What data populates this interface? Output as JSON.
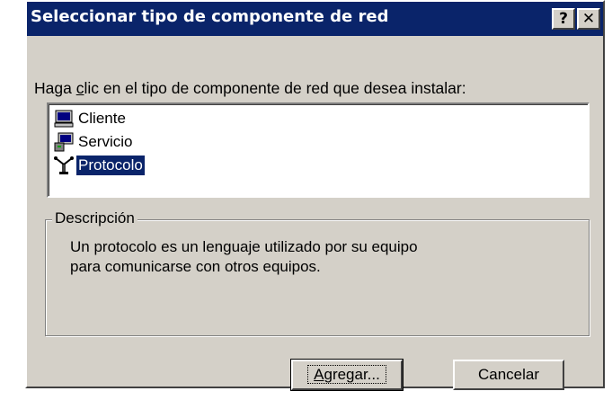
{
  "window": {
    "title": "Seleccionar tipo de componente de red",
    "help_label": "?",
    "close_label": "✕"
  },
  "prompt": {
    "before": "Haga ",
    "underlined": "c",
    "after": "lic en el tipo de componente de red que desea instalar:"
  },
  "list": {
    "items": [
      {
        "label": "Cliente",
        "icon": "computer-icon"
      },
      {
        "label": "Servicio",
        "icon": "server-icon"
      },
      {
        "label": "Protocolo",
        "icon": "network-protocol-icon"
      }
    ],
    "selected": "Protocolo"
  },
  "description": {
    "group_title": "Descripción",
    "line1": "Un protocolo es un lenguaje utilizado por su equipo",
    "line2": "para comunicarse con otros equipos."
  },
  "buttons": {
    "add_underlined": "A",
    "add_rest": "gregar...",
    "cancel": "Cancelar"
  },
  "colors": {
    "titlebar": "#0a246a",
    "face": "#d4d0c8",
    "selection": "#0a246a"
  }
}
